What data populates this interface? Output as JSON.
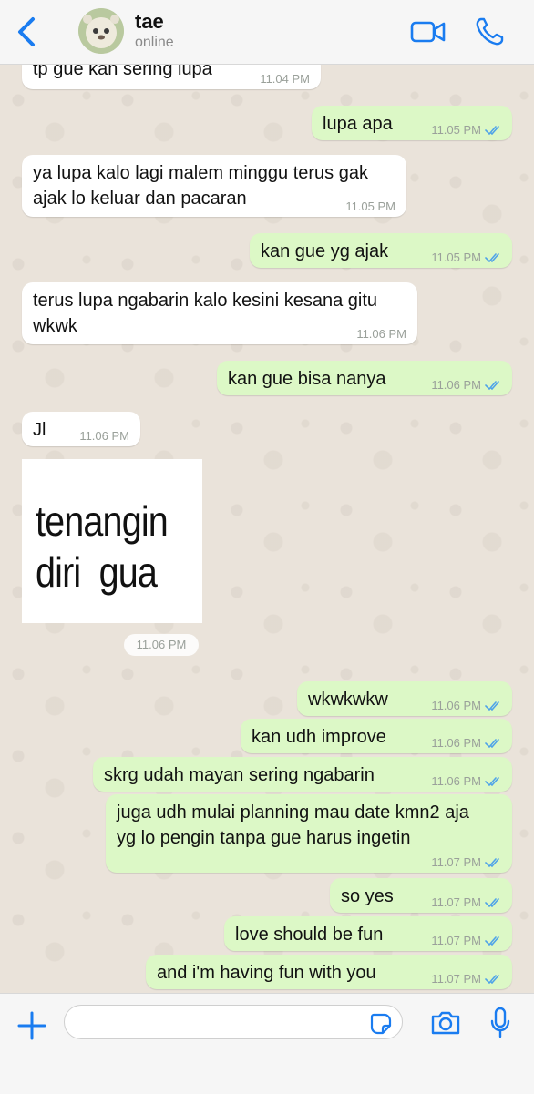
{
  "header": {
    "name": "tae",
    "status": "online"
  },
  "messages": [
    {
      "dir": "in",
      "text": "tp gue kan sering lupa",
      "time": "11.04 PM"
    },
    {
      "dir": "out",
      "text": "lupa apa",
      "time": "11.05 PM"
    },
    {
      "dir": "in",
      "text": "ya lupa kalo lagi malem minggu terus gak\najak lo keluar dan pacaran",
      "time": "11.05 PM"
    },
    {
      "dir": "out",
      "text": "kan gue yg ajak",
      "time": "11.05 PM"
    },
    {
      "dir": "in",
      "text": "terus lupa ngabarin kalo kesini kesana gitu\nwkwk",
      "time": "11.06 PM"
    },
    {
      "dir": "out",
      "text": "kan gue bisa nanya",
      "time": "11.06 PM"
    },
    {
      "dir": "in",
      "text": "Jl",
      "time": "11.06 PM"
    },
    {
      "dir": "in",
      "image_text": "tenangin\ndiri  gua",
      "time": "11.06 PM"
    },
    {
      "dir": "out",
      "text": "wkwkwkw",
      "time": "11.06 PM"
    },
    {
      "dir": "out",
      "text": "kan udh improve",
      "time": "11.06 PM"
    },
    {
      "dir": "out",
      "text": "skrg udah mayan sering ngabarin",
      "time": "11.06 PM"
    },
    {
      "dir": "out",
      "text": "juga udh mulai planning mau date kmn2 aja\nyg lo pengin tanpa gue harus ingetin",
      "time": "11.07 PM"
    },
    {
      "dir": "out",
      "text": "so yes",
      "time": "11.07 PM"
    },
    {
      "dir": "out",
      "text": "love should be fun",
      "time": "11.07 PM"
    },
    {
      "dir": "out",
      "text": "and i'm having fun with you",
      "time": "11.07 PM"
    }
  ],
  "colors": {
    "accent": "#1a7cf0",
    "outgoing_bubble": "#dcf8c6",
    "incoming_bubble": "#ffffff",
    "read_ticks": "#4fa3e8"
  },
  "icons": {
    "back": "chevron-left-icon",
    "video": "video-camera-icon",
    "call": "phone-icon",
    "plus": "plus-icon",
    "sticker": "sticker-icon",
    "camera": "camera-icon",
    "mic": "microphone-icon"
  }
}
